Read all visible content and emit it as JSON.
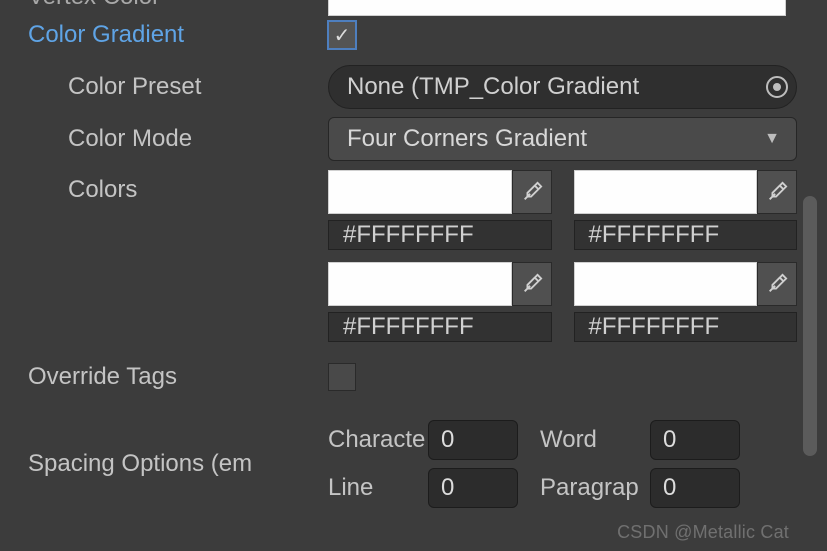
{
  "top_cut_label": "Vertex Color",
  "gradient": {
    "label": "Color Gradient",
    "checked": true
  },
  "preset": {
    "label": "Color Preset",
    "value": "None (TMP_Color Gradient"
  },
  "mode": {
    "label": "Color Mode",
    "value": "Four Corners Gradient"
  },
  "colors": {
    "label": "Colors",
    "hex": [
      "#FFFFFFFF",
      "#FFFFFFFF",
      "#FFFFFFFF",
      "#FFFFFFFF"
    ]
  },
  "override": {
    "label": "Override Tags",
    "checked": false
  },
  "spacing": {
    "label": "Spacing Options (em",
    "char_label": "Characte",
    "char_value": "0",
    "word_label": "Word",
    "word_value": "0",
    "line_label": "Line",
    "line_value": "0",
    "para_label": "Paragrap",
    "para_value": "0"
  },
  "watermark": "CSDN @Metallic Cat"
}
